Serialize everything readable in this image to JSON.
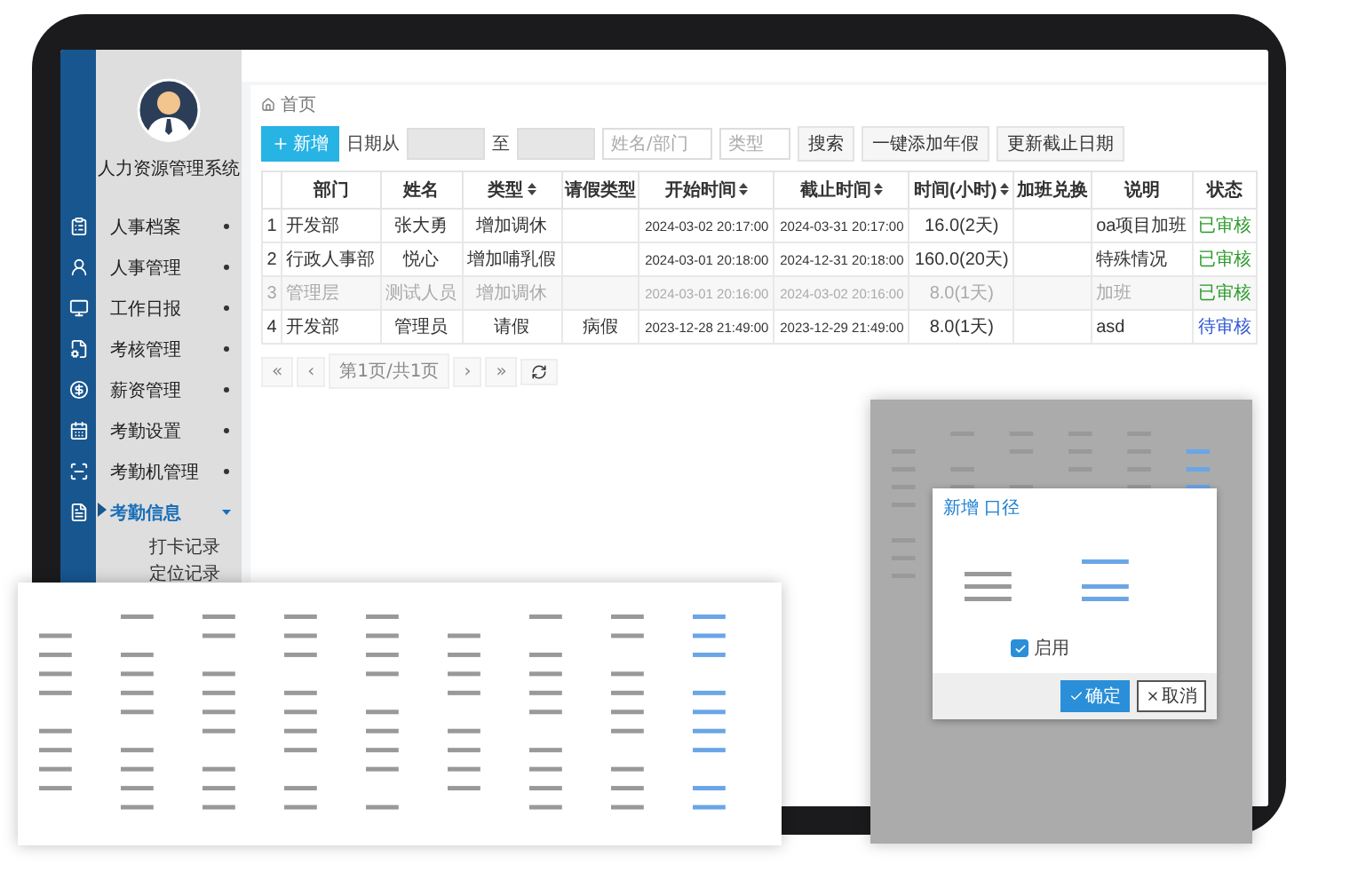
{
  "sidebar": {
    "title": "人力资源管理系统",
    "items": [
      {
        "label": "人事档案",
        "selected": false,
        "expanded": false
      },
      {
        "label": "人事管理",
        "selected": false,
        "expanded": false
      },
      {
        "label": "工作日报",
        "selected": false,
        "expanded": false
      },
      {
        "label": "考核管理",
        "selected": false,
        "expanded": false
      },
      {
        "label": "薪资管理",
        "selected": false,
        "expanded": false
      },
      {
        "label": "考勤设置",
        "selected": false,
        "expanded": false
      },
      {
        "label": "考勤机管理",
        "selected": false,
        "expanded": false
      },
      {
        "label": "考勤信息",
        "selected": true,
        "expanded": true,
        "children": [
          {
            "label": "打卡记录"
          },
          {
            "label": "定位记录"
          }
        ]
      }
    ]
  },
  "breadcrumb": "首页",
  "toolbar": {
    "add_button": "新增",
    "date_from_label": "日期从",
    "date_to_label": "至",
    "name_placeholder": "姓名/部门",
    "type_placeholder": "类型",
    "buttons": [
      "搜索",
      "一键添加年假",
      "更新截止日期"
    ]
  },
  "table": {
    "columns": [
      {
        "sortable": false
      },
      {
        "label": "部门",
        "sortable": false
      },
      {
        "label": "姓名",
        "sortable": false
      },
      {
        "label": "类型",
        "sortable": true
      },
      {
        "label": "请假类型",
        "sortable": false
      },
      {
        "label": "开始时间",
        "sortable": true
      },
      {
        "label": "截止时间",
        "sortable": true
      },
      {
        "label": "时间(小时)",
        "sortable": true
      },
      {
        "label": "加班兑换",
        "sortable": false
      },
      {
        "label": "说明",
        "sortable": false
      },
      {
        "label": "状态",
        "sortable": false
      }
    ],
    "rows": [
      {
        "index": "1",
        "dept": "开发部",
        "name": "张大勇",
        "type": "增加调休",
        "start": "2024-03-02 20:17:00",
        "end": "2024-03-31 20:17:00",
        "hours": "16.0(2天)",
        "note": "oa项目加班",
        "status": {
          "label": "已审核",
          "kind": "approved"
        },
        "disabled": false
      },
      {
        "index": "2",
        "dept": "行政人事部",
        "name": "悦心",
        "type": "增加哺乳假",
        "start": "2024-03-01 20:18:00",
        "end": "2024-12-31 20:18:00",
        "hours": "160.0(20天)",
        "note": "特殊情况",
        "status": {
          "label": "已审核",
          "kind": "approved"
        },
        "disabled": false
      },
      {
        "index": "3",
        "dept": "管理层",
        "name": "测试人员",
        "type": "增加调休",
        "start": "2024-03-01 20:16:00",
        "end": "2024-03-02 20:16:00",
        "hours": "8.0(1天)",
        "note": "加班",
        "status": {
          "label": "已审核",
          "kind": "approved"
        },
        "disabled": true
      },
      {
        "index": "4",
        "dept": "开发部",
        "name": "管理员",
        "type": "请假",
        "leave_type": "病假",
        "start": "2023-12-28 21:49:00",
        "end": "2023-12-29 21:49:00",
        "hours": "8.0(1天)",
        "note": "asd",
        "status": {
          "label": "待审核",
          "kind": "pending"
        },
        "disabled": false
      }
    ]
  },
  "pagination": {
    "first": "«",
    "prev": "‹",
    "page": "第1页/共1页",
    "next": "›",
    "last": "»"
  },
  "modal": {
    "title": "新增 口径",
    "checkbox": {
      "label": "启用",
      "checked": true
    },
    "buttons": [
      {
        "label": "确定",
        "kind": "primary"
      },
      {
        "label": "取消",
        "kind": "default"
      }
    ]
  }
}
